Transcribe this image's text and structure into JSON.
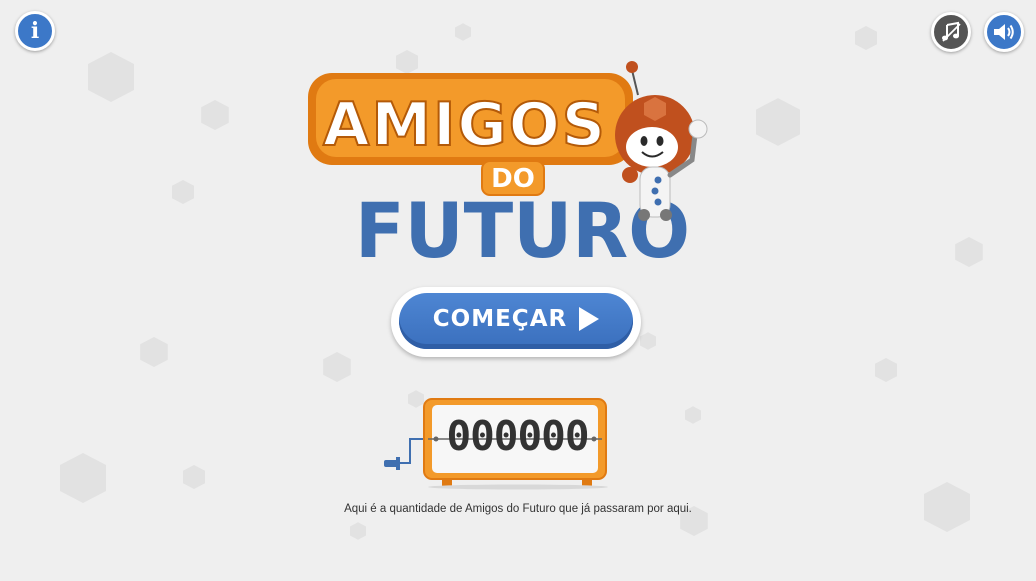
{
  "header": {
    "info_icon": "info-icon",
    "music_icon": "music-note-icon",
    "sound_icon": "speaker-volume-icon"
  },
  "logo": {
    "line1": "AMIGOS",
    "line2": "DO",
    "line3": "FUTURO"
  },
  "start_button": {
    "label": "COMEÇAR",
    "icon": "play-icon"
  },
  "counter": {
    "value": "000000",
    "caption": "Aqui é a quantidade de Amigos do Futuro que já passaram por aqui."
  },
  "colors": {
    "background": "#efefef",
    "primary_blue": "#3c78c8",
    "logo_orange": "#f08a1c",
    "logo_blue": "#3f6fb0"
  }
}
